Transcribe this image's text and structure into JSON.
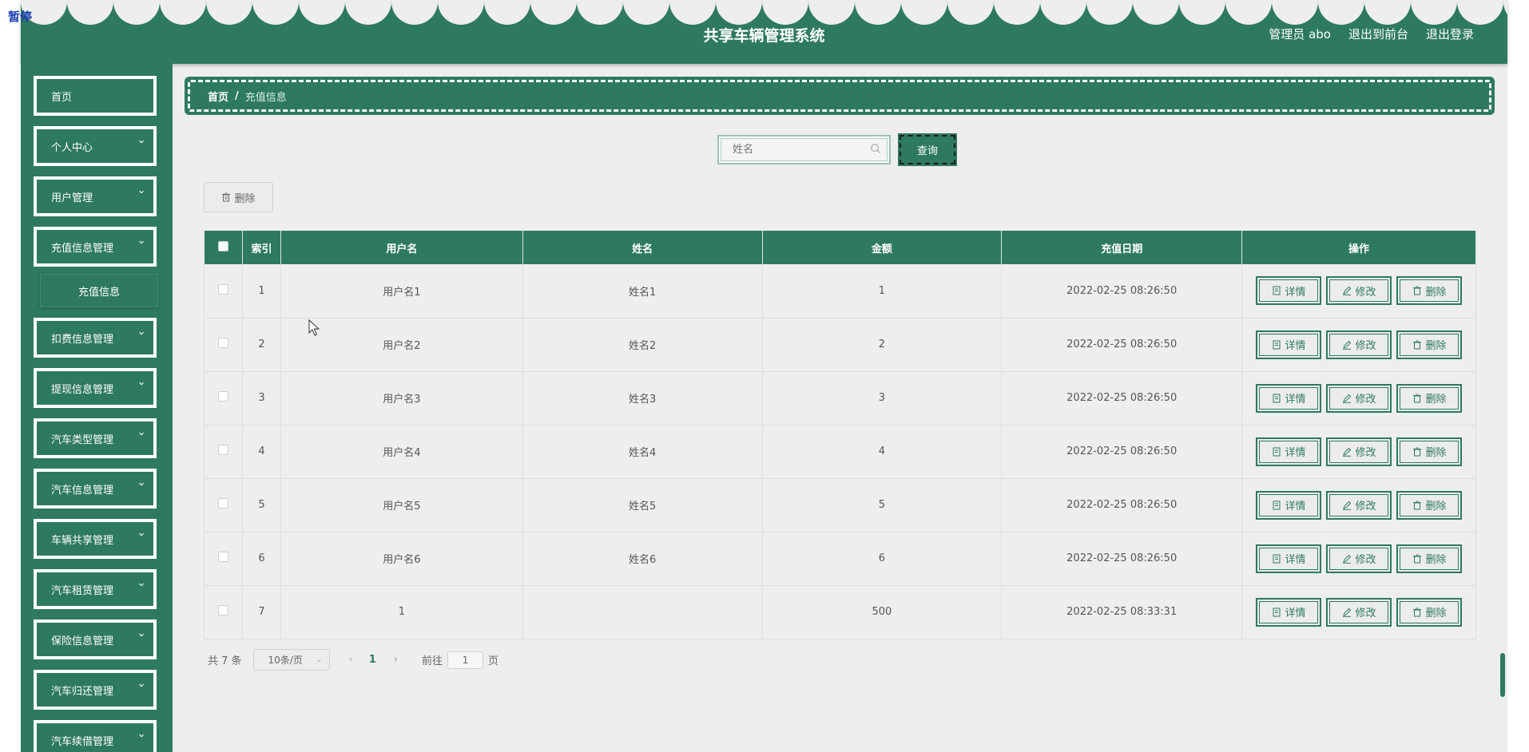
{
  "overlay": {
    "pause_label": "暂停"
  },
  "header": {
    "title": "共享车辆管理系统",
    "admin_label": "管理员 abo",
    "front_label": "退出到前台",
    "logout_label": "退出登录"
  },
  "sidebar": {
    "items": [
      {
        "label": "首页",
        "expandable": false
      },
      {
        "label": "个人中心",
        "expandable": true
      },
      {
        "label": "用户管理",
        "expandable": true
      },
      {
        "label": "充值信息管理",
        "expandable": true
      },
      {
        "label": "扣费信息管理",
        "expandable": true
      },
      {
        "label": "提现信息管理",
        "expandable": true
      },
      {
        "label": "汽车类型管理",
        "expandable": true
      },
      {
        "label": "汽车信息管理",
        "expandable": true
      },
      {
        "label": "车辆共享管理",
        "expandable": true
      },
      {
        "label": "汽车租赁管理",
        "expandable": true
      },
      {
        "label": "保险信息管理",
        "expandable": true
      },
      {
        "label": "汽车归还管理",
        "expandable": true
      },
      {
        "label": "汽车续借管理",
        "expandable": true
      }
    ],
    "submenu_label": "充值信息"
  },
  "breadcrumb": {
    "home": "首页",
    "separator": "/",
    "current": "充值信息"
  },
  "search": {
    "placeholder": "姓名",
    "value": "",
    "button_label": "查询"
  },
  "toolbar": {
    "delete_label": "删除"
  },
  "table": {
    "columns": [
      "索引",
      "用户名",
      "姓名",
      "金额",
      "充值日期",
      "操作"
    ],
    "rows": [
      {
        "index": "1",
        "username": "用户名1",
        "name": "姓名1",
        "amount": "1",
        "date": "2022-02-25 08:26:50"
      },
      {
        "index": "2",
        "username": "用户名2",
        "name": "姓名2",
        "amount": "2",
        "date": "2022-02-25 08:26:50"
      },
      {
        "index": "3",
        "username": "用户名3",
        "name": "姓名3",
        "amount": "3",
        "date": "2022-02-25 08:26:50"
      },
      {
        "index": "4",
        "username": "用户名4",
        "name": "姓名4",
        "amount": "4",
        "date": "2022-02-25 08:26:50"
      },
      {
        "index": "5",
        "username": "用户名5",
        "name": "姓名5",
        "amount": "5",
        "date": "2022-02-25 08:26:50"
      },
      {
        "index": "6",
        "username": "用户名6",
        "name": "姓名6",
        "amount": "6",
        "date": "2022-02-25 08:26:50"
      },
      {
        "index": "7",
        "username": "1",
        "name": "",
        "amount": "500",
        "date": "2022-02-25 08:33:31"
      }
    ],
    "actions": {
      "detail": "详情",
      "edit": "修改",
      "delete": "删除"
    }
  },
  "pagination": {
    "total_label": "共 7 条",
    "page_size": "10条/页",
    "current_page": "1",
    "goto_label": "前往",
    "goto_value": "1",
    "page_suffix": "页"
  },
  "colors": {
    "primary": "#2e7a5e",
    "background": "#eeeeee"
  }
}
